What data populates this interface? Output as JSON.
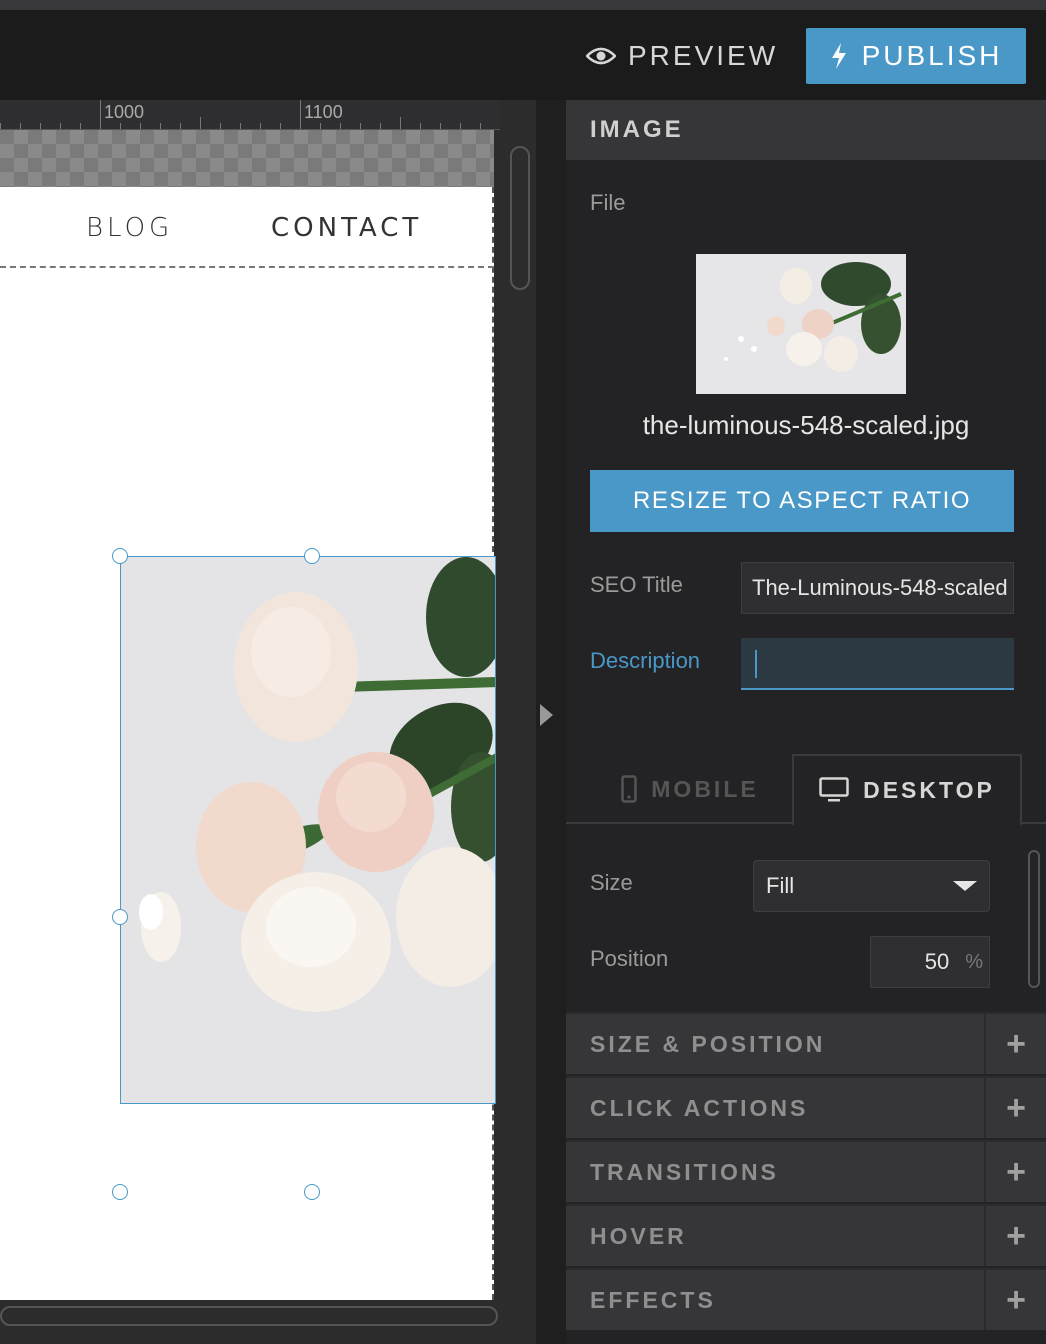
{
  "toolbar": {
    "preview_label": "PREVIEW",
    "publish_label": "PUBLISH"
  },
  "ruler": {
    "labels": [
      "1000",
      "1100"
    ]
  },
  "site_nav": {
    "items": [
      "BLOG",
      "CONTACT"
    ]
  },
  "panel": {
    "header": "IMAGE",
    "file_label": "File",
    "filename": "the-luminous-548-scaled.jpg",
    "resize_button": "RESIZE TO ASPECT RATIO",
    "seo_title_label": "SEO Title",
    "seo_title_value": "The-Luminous-548-scaled",
    "description_label": "Description",
    "description_value": "",
    "tabs": {
      "mobile": "MOBILE",
      "desktop": "DESKTOP",
      "active": "desktop"
    },
    "size_label": "Size",
    "size_value": "Fill",
    "position_label": "Position",
    "position_value": "50",
    "position_unit": "%",
    "sections": [
      "SIZE & POSITION",
      "CLICK ACTIONS",
      "TRANSITIONS",
      "HOVER",
      "EFFECTS"
    ]
  },
  "icons": {
    "preview": "eye-icon",
    "publish": "lightning-icon",
    "mobile_tab": "phone-icon",
    "desktop_tab": "monitor-icon",
    "size_dropdown": "caret-down-icon",
    "section_toggle": "plus-icon",
    "panel_toggle": "caret-right-icon"
  },
  "colors": {
    "accent": "#4a98c7",
    "panel_bg": "#232325",
    "section_bg": "#363638"
  }
}
